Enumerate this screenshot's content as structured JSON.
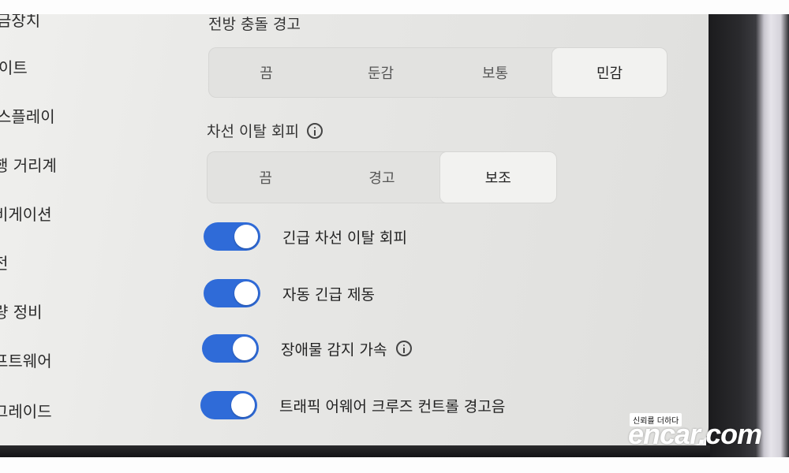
{
  "sidebar": {
    "items": [
      {
        "label": "금장치"
      },
      {
        "label": "이트"
      },
      {
        "label": "스플레이"
      },
      {
        "label": "행 거리계"
      },
      {
        "label": "비게이션"
      },
      {
        "label": "전"
      },
      {
        "label": "량 정비"
      },
      {
        "label": "프트웨어"
      },
      {
        "label": "그레이드"
      }
    ]
  },
  "forward_collision": {
    "title": "전방 충돌 경고",
    "options": [
      "끔",
      "둔감",
      "보통",
      "민감"
    ],
    "selected": "민감"
  },
  "lane_departure": {
    "title": "차선 이탈 회피",
    "info_icon": "info-icon",
    "options": [
      "끔",
      "경고",
      "보조"
    ],
    "selected": "보조"
  },
  "toggles": [
    {
      "label": "긴급 차선 이탈 회피",
      "on": true,
      "has_info": false
    },
    {
      "label": "자동 긴급 제동",
      "on": true,
      "has_info": false
    },
    {
      "label": "장애물 감지 가속",
      "on": true,
      "has_info": true
    },
    {
      "label": "트래픽 어웨어 크루즈 컨트롤 경고음",
      "on": true,
      "has_info": false
    }
  ],
  "watermark": {
    "tag": "신뢰를 더하다",
    "logo": "encar.com"
  },
  "colors": {
    "toggle_on": "#2f6bd8",
    "screen_bg": "#e8e8e6"
  }
}
